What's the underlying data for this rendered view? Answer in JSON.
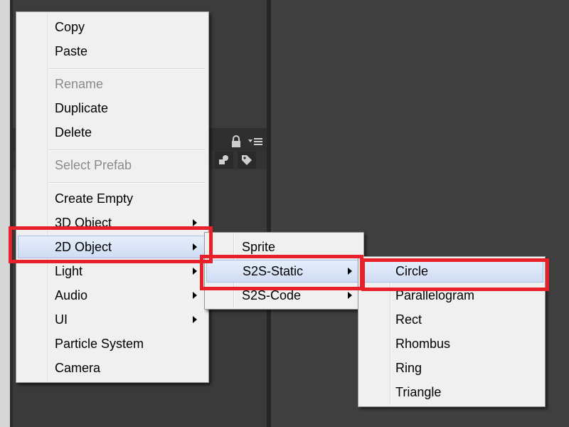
{
  "context_menu": {
    "items": [
      {
        "label": "Copy"
      },
      {
        "label": "Paste"
      },
      {
        "label": "Rename"
      },
      {
        "label": "Duplicate"
      },
      {
        "label": "Delete"
      },
      {
        "label": "Select Prefab"
      },
      {
        "label": "Create Empty"
      },
      {
        "label": "3D Object"
      },
      {
        "label": "2D Object"
      },
      {
        "label": "Light"
      },
      {
        "label": "Audio"
      },
      {
        "label": "UI"
      },
      {
        "label": "Particle System"
      },
      {
        "label": "Camera"
      }
    ]
  },
  "submenu_2d": {
    "items": [
      {
        "label": "Sprite"
      },
      {
        "label": "S2S-Static"
      },
      {
        "label": "S2S-Code"
      }
    ]
  },
  "submenu_static": {
    "items": [
      {
        "label": "Circle"
      },
      {
        "label": "Parallelogram"
      },
      {
        "label": "Rect"
      },
      {
        "label": "Rhombus"
      },
      {
        "label": "Ring"
      },
      {
        "label": "Triangle"
      }
    ]
  },
  "colors": {
    "annotation": "#e8202a",
    "menu_background": "#f0f0f0",
    "highlight": "#cfdcf3",
    "editor_background": "#383838"
  }
}
